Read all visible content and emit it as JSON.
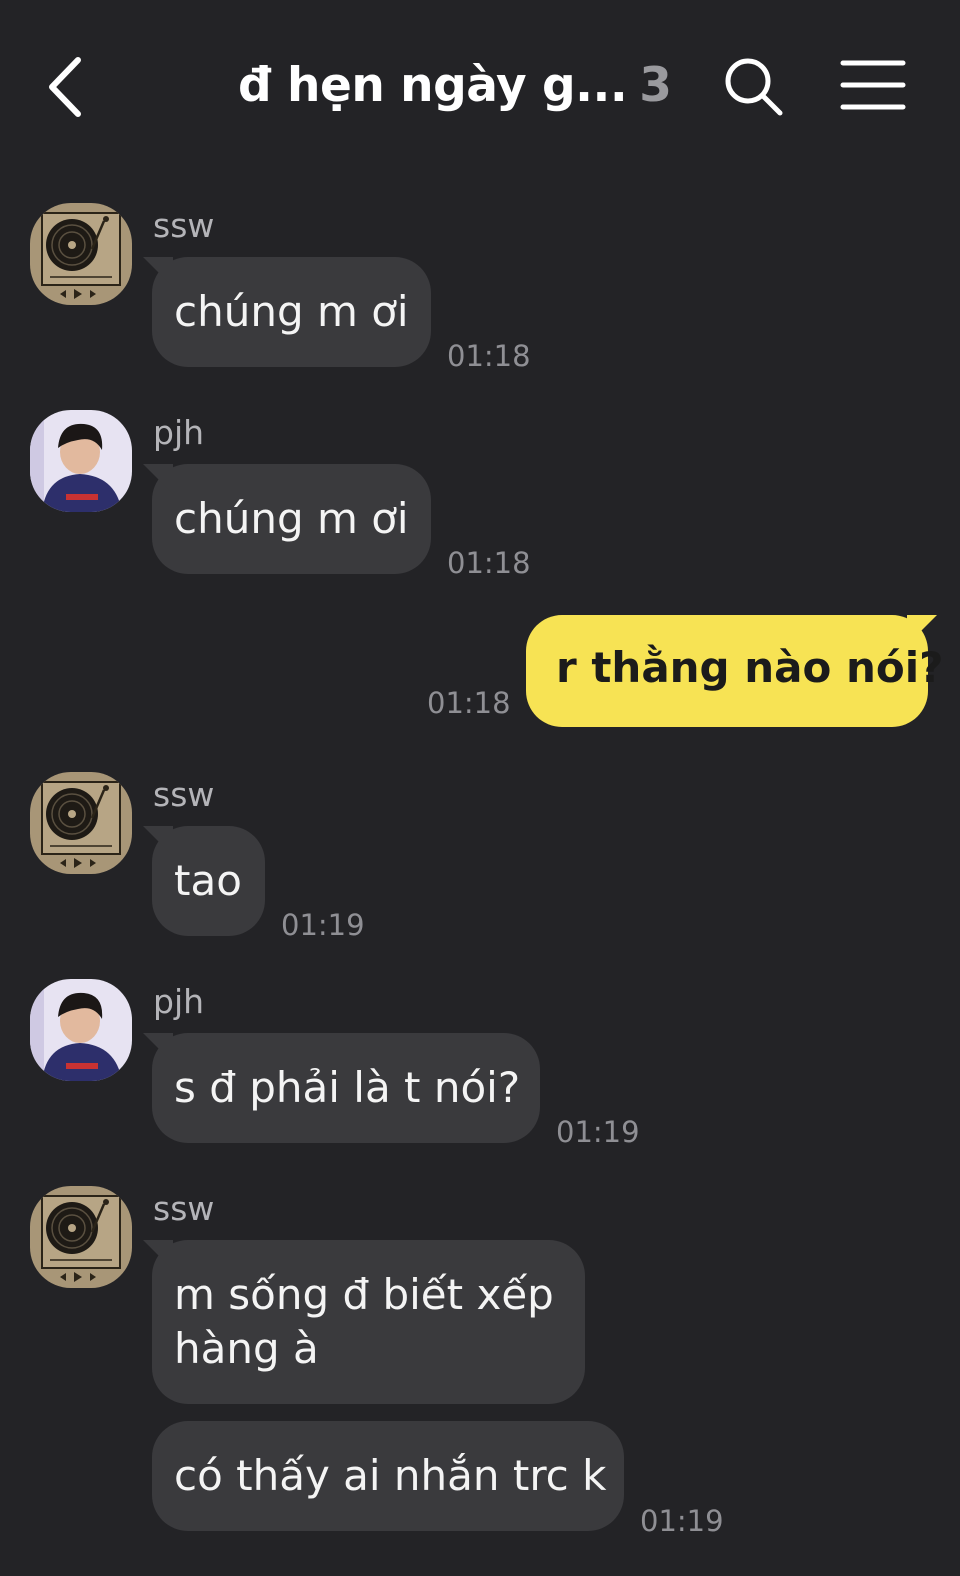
{
  "header": {
    "title": "đ hẹn ngày g...",
    "member_count": "3"
  },
  "messages": [
    {
      "sender": "ssw",
      "text": "chúng m ơi",
      "time": "01:18"
    },
    {
      "sender": "pjh",
      "text": "chúng m ơi",
      "time": "01:18"
    },
    {
      "sender": "me",
      "text": "r thằng nào nói?",
      "time": "01:18"
    },
    {
      "sender": "ssw",
      "text": "tao",
      "time": "01:19"
    },
    {
      "sender": "pjh",
      "text": "s đ phải là t nói?",
      "time": "01:19"
    },
    {
      "sender": "ssw",
      "text": "m sống đ biết xếp hàng à",
      "time": ""
    },
    {
      "sender": "ssw",
      "text": "có thấy ai nhắn trc k",
      "time": "01:19"
    }
  ],
  "colors": {
    "background": "#232326",
    "incoming_bubble": "#3a3a3d",
    "outgoing_bubble": "#f7e354",
    "timestamp": "#8f8f94"
  },
  "icons": {
    "back": "chevron-left-icon",
    "search": "search-icon",
    "menu": "hamburger-menu-icon"
  }
}
